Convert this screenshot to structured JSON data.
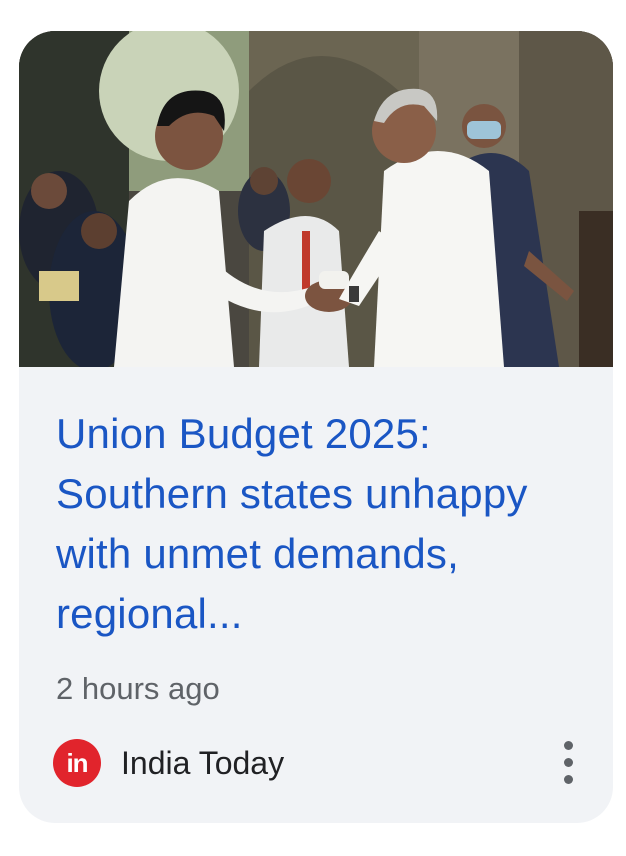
{
  "card": {
    "image_icon": "news-photo",
    "headline": "Union Budget 2025: Southern states unhappy with unmet demands, regional...",
    "time_ago": "2 hours ago",
    "source": {
      "logo_text": "in",
      "logo_color": "#e1242c",
      "name": "India Today"
    },
    "more_icon": "more-vert-icon"
  },
  "colors": {
    "headline": "#1a56c4",
    "card_background": "#f1f3f6",
    "secondary_text": "#5f6368"
  }
}
